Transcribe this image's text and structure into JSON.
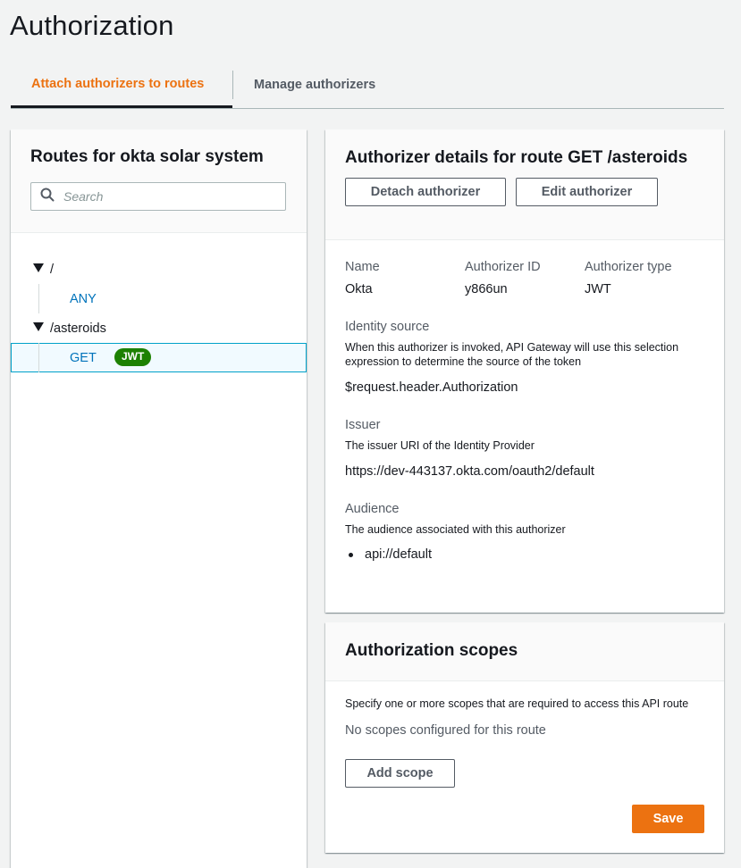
{
  "page": {
    "title": "Authorization"
  },
  "tabs": [
    {
      "label": "Attach authorizers to routes",
      "active": true
    },
    {
      "label": "Manage authorizers",
      "active": false
    }
  ],
  "routes_panel": {
    "title": "Routes for okta solar system",
    "search_placeholder": "Search",
    "tree": [
      {
        "path": "/",
        "methods": [
          {
            "method": "ANY",
            "badge": ""
          }
        ]
      },
      {
        "path": "/asteroids",
        "methods": [
          {
            "method": "GET",
            "badge": "JWT"
          }
        ]
      }
    ]
  },
  "details": {
    "title": "Authorizer details for route GET /asteroids",
    "detach_label": "Detach authorizer",
    "edit_label": "Edit authorizer",
    "fields": [
      {
        "label": "Name",
        "value": "Okta"
      },
      {
        "label": "Authorizer ID",
        "value": "y866un"
      },
      {
        "label": "Authorizer type",
        "value": "JWT"
      }
    ],
    "identity_source": {
      "label": "Identity source",
      "description": "When this authorizer is invoked, API Gateway will use this selection expression to determine the source of the token",
      "value": "$request.header.Authorization"
    },
    "issuer": {
      "label": "Issuer",
      "description": "The issuer URI of the Identity Provider",
      "value": "https://dev-443137.okta.com/oauth2/default"
    },
    "audience": {
      "label": "Audience",
      "description": "The audience associated with this authorizer",
      "items": [
        "api://default"
      ]
    }
  },
  "scopes": {
    "title": "Authorization scopes",
    "description": "Specify one or more scopes that are required to access this API route",
    "empty_text": "No scopes configured for this route",
    "add_label": "Add scope",
    "save_label": "Save"
  },
  "colors": {
    "accent": "#ec7211",
    "link": "#0073bb",
    "badge_green": "#1d8102",
    "selected_border": "#00a1c9"
  }
}
